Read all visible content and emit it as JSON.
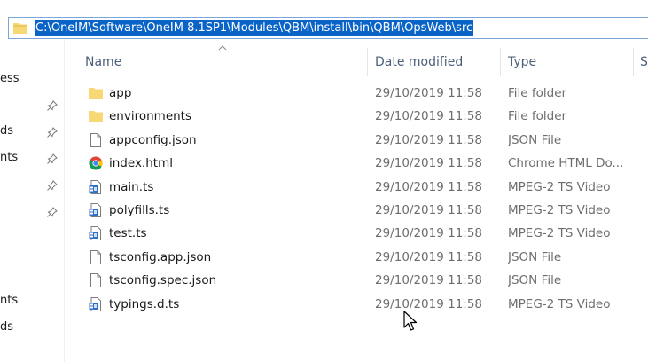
{
  "address_bar": {
    "path": "C:\\OneIM\\Software\\OneIM 8.1SP1\\Modules\\QBM\\install\\bin\\QBM\\OpsWeb\\src"
  },
  "nav_pane": {
    "items": [
      {
        "label": "ess",
        "pinned": false
      },
      {
        "label": "ds",
        "pinned": true
      },
      {
        "label": "nts",
        "pinned": true
      },
      {
        "label": "",
        "pinned": true
      },
      {
        "label": "",
        "pinned": true
      },
      {
        "label": "nts",
        "pinned": false
      },
      {
        "label": "ds",
        "pinned": false
      }
    ]
  },
  "columns": {
    "name": "Name",
    "date_modified": "Date modified",
    "type": "Type",
    "size": "S"
  },
  "files": [
    {
      "name": "app",
      "date": "29/10/2019 11:58",
      "type": "File folder",
      "icon": "folder-icon"
    },
    {
      "name": "environments",
      "date": "29/10/2019 11:58",
      "type": "File folder",
      "icon": "folder-icon"
    },
    {
      "name": "appconfig.json",
      "date": "29/10/2019 11:58",
      "type": "JSON File",
      "icon": "file-icon"
    },
    {
      "name": "index.html",
      "date": "29/10/2019 11:58",
      "type": "Chrome HTML Do...",
      "icon": "chrome-icon"
    },
    {
      "name": "main.ts",
      "date": "29/10/2019 11:58",
      "type": "MPEG-2 TS Video",
      "icon": "video-file-icon"
    },
    {
      "name": "polyfills.ts",
      "date": "29/10/2019 11:58",
      "type": "MPEG-2 TS Video",
      "icon": "video-file-icon"
    },
    {
      "name": "test.ts",
      "date": "29/10/2019 11:58",
      "type": "MPEG-2 TS Video",
      "icon": "video-file-icon"
    },
    {
      "name": "tsconfig.app.json",
      "date": "29/10/2019 11:58",
      "type": "JSON File",
      "icon": "file-icon"
    },
    {
      "name": "tsconfig.spec.json",
      "date": "29/10/2019 11:58",
      "type": "JSON File",
      "icon": "file-icon"
    },
    {
      "name": "typings.d.ts",
      "date": "29/10/2019 11:58",
      "type": "MPEG-2 TS Video",
      "icon": "video-file-icon"
    }
  ],
  "colors": {
    "selection": "#0a64c8",
    "header_text": "#4c607a",
    "folder": "#f8d775"
  }
}
